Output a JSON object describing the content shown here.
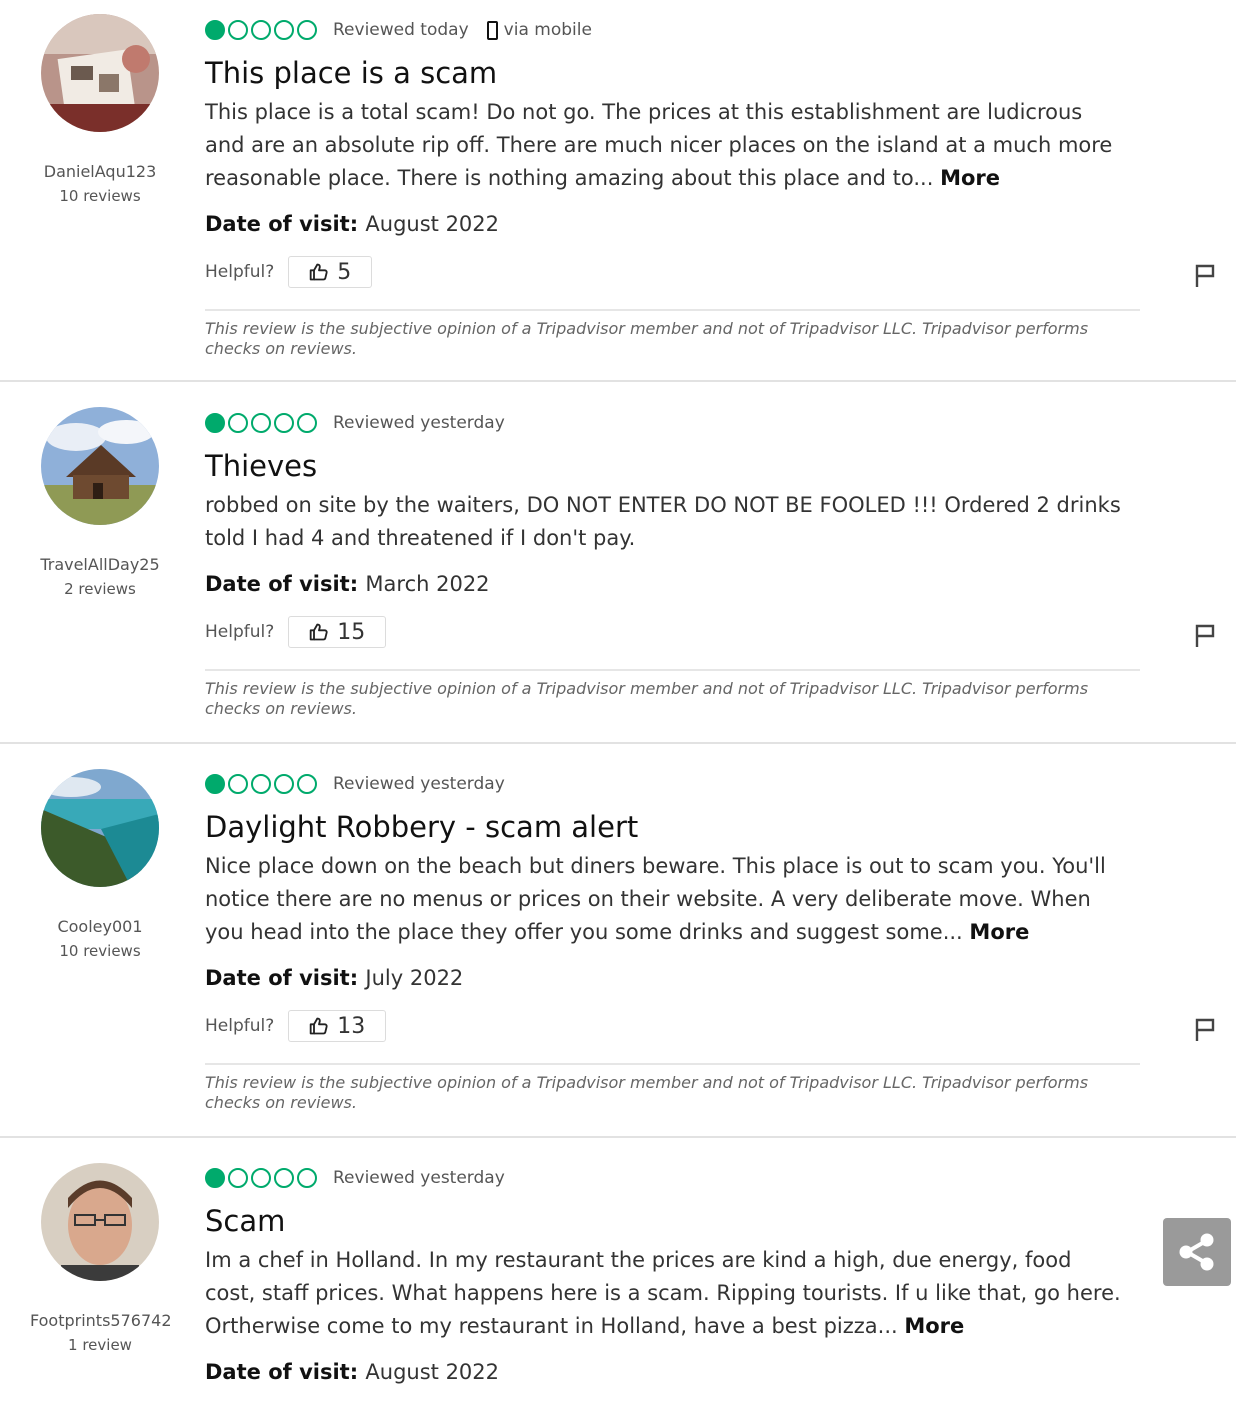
{
  "reviews": [
    {
      "username": "DanielAqu123",
      "review_count": "10 reviews",
      "avatar": "photo-avatar",
      "rating": 1,
      "reviewed": "Reviewed today",
      "via": "via mobile",
      "title": "This place is a scam",
      "text": "This place is a total scam! Do not go. The prices at this establishment are ludicrous and are an absolute rip off. There are much nicer places on the island at a much more reasonable place. There is nothing amazing about this place and to...",
      "more": "More",
      "date_label": "Date of visit:",
      "date_value": "August 2022",
      "helpful_label": "Helpful?",
      "helpful_count": "5",
      "disclaimer": "This review is the subjective opinion of a Tripadvisor member and not of Tripadvisor LLC. Tripadvisor performs checks on reviews."
    },
    {
      "username": "TravelAllDay25",
      "review_count": "2 reviews",
      "avatar": "cabin-avatar",
      "rating": 1,
      "reviewed": "Reviewed yesterday",
      "title": "Thieves",
      "text": "robbed on site by the waiters, DO NOT ENTER DO NOT BE FOOLED !!! Ordered 2 drinks told I had 4 and threatened if I don't pay.",
      "date_label": "Date of visit:",
      "date_value": "March 2022",
      "helpful_label": "Helpful?",
      "helpful_count": "15",
      "disclaimer": "This review is the subjective opinion of a Tripadvisor member and not of Tripadvisor LLC. Tripadvisor performs checks on reviews."
    },
    {
      "username": "Cooley001",
      "review_count": "10 reviews",
      "avatar": "beach-avatar",
      "rating": 1,
      "reviewed": "Reviewed yesterday",
      "title": "Daylight Robbery - scam alert",
      "text": "Nice place down on the beach but diners beware. This place is out to scam you. You'll notice there are no menus or prices on their website. A very deliberate move. When you head into the place they offer you some drinks and suggest some...",
      "more": "More",
      "date_label": "Date of visit:",
      "date_value": "July 2022",
      "helpful_label": "Helpful?",
      "helpful_count": "13",
      "disclaimer": "This review is the subjective opinion of a Tripadvisor member and not of Tripadvisor LLC. Tripadvisor performs checks on reviews."
    },
    {
      "username": "Footprints576742",
      "review_count": "1 review",
      "avatar": "person-avatar",
      "rating": 1,
      "reviewed": "Reviewed yesterday",
      "title": "Scam",
      "text": "Im a chef in Holland. In my restaurant the prices are kind a high, due energy, food cost, staff prices. What happens here is a scam. Ripping tourists. If u like that, go here. Ortherwise come to my restaurant in Holland, have a best pizza...",
      "more": "More",
      "date_label": "Date of visit:",
      "date_value": "August 2022"
    }
  ],
  "colors": {
    "bubble": "#00aa6c",
    "share_bg": "#9a9a9a"
  },
  "icons": [
    "phone-icon",
    "thumbs-up-icon",
    "flag-icon",
    "share-icon"
  ]
}
